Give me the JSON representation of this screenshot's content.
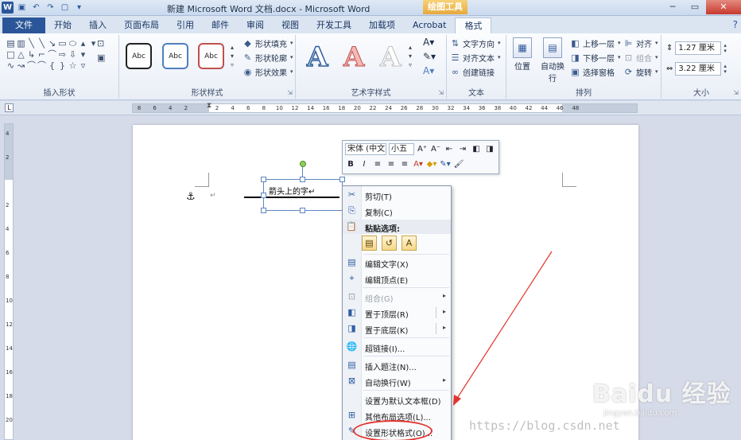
{
  "title": "新建 Microsoft Word 文档.docx - Microsoft Word",
  "context_tab": "绘图工具",
  "tabs": [
    {
      "label": "文件"
    },
    {
      "label": "开始"
    },
    {
      "label": "插入"
    },
    {
      "label": "页面布局"
    },
    {
      "label": "引用"
    },
    {
      "label": "邮件"
    },
    {
      "label": "审阅"
    },
    {
      "label": "视图"
    },
    {
      "label": "开发工具"
    },
    {
      "label": "加载项"
    },
    {
      "label": "Acrobat"
    },
    {
      "label": "格式"
    }
  ],
  "ribbon": {
    "insert_shapes": {
      "label": "插入形状"
    },
    "shape_styles": {
      "label": "形状样式",
      "sample": "Abc",
      "fill": "形状填充",
      "outline": "形状轮廓",
      "effects": "形状效果"
    },
    "wordart": {
      "label": "艺术字样式",
      "letter": "A"
    },
    "text": {
      "label": "文本",
      "direction": "文字方向",
      "align": "对齐文本",
      "link": "创建链接"
    },
    "arrange": {
      "label": "排列",
      "position": "位置",
      "wrap": "自动换行",
      "forward": "上移一层",
      "backward": "下移一层",
      "pane": "选择窗格",
      "align": "对齐",
      "group": "组合",
      "rotate": "旋转"
    },
    "size": {
      "label": "大小",
      "height": "1.27 厘米",
      "width": "3.22 厘米"
    }
  },
  "ruler_ticks": [
    "8",
    "6",
    "4",
    "2",
    "",
    "2",
    "4",
    "6",
    "8",
    "10",
    "12",
    "14",
    "16",
    "18",
    "20",
    "22",
    "24",
    "26",
    "28",
    "30",
    "32",
    "34",
    "36",
    "38",
    "40",
    "42",
    "44",
    "46",
    "48"
  ],
  "vruler_ticks": [
    "4",
    "2",
    "",
    "2",
    "4",
    "6",
    "8",
    "10",
    "12",
    "14",
    "16",
    "18",
    "20"
  ],
  "textbox_text": "箭头上的字↵",
  "paragraph_mark": "↵",
  "minibar": {
    "font": "宋体 (中文",
    "size": "小五"
  },
  "context_menu": {
    "paste_header": "粘贴选项:",
    "items": [
      {
        "label": "剪切(T)"
      },
      {
        "label": "复制(C)"
      },
      {
        "label": "编辑文字(X)"
      },
      {
        "label": "编辑顶点(E)"
      },
      {
        "label": "组合(G)"
      },
      {
        "label": "置于顶层(R)"
      },
      {
        "label": "置于底层(K)"
      },
      {
        "label": "超链接(I)..."
      },
      {
        "label": "插入题注(N)..."
      },
      {
        "label": "自动换行(W)"
      },
      {
        "label": "设置为默认文本框(D)"
      },
      {
        "label": "其他布局选项(L)..."
      },
      {
        "label": "设置形状格式(O)..."
      }
    ]
  },
  "watermark": {
    "brand": "Baidu 经验",
    "url": "jingyan.baidu.com",
    "csdn": "https://blog.csdn.net"
  },
  "colors": {
    "accent": "#2b579a",
    "highlight": "#e3342f",
    "context_tab": "#e7a93c"
  }
}
